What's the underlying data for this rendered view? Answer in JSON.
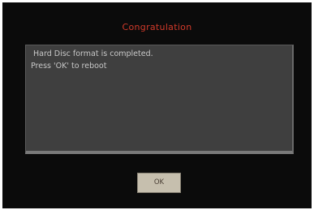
{
  "dialog": {
    "title": "Congratulation",
    "message_lines": [
      "Hard Disc format is completed.",
      "Press 'OK' to reboot"
    ],
    "ok_label": "OK"
  },
  "colors": {
    "background": "#0b0b0b",
    "title": "#d23a2a",
    "message_box": "#3f3f3f",
    "message_text": "#c8c8c8",
    "button_face": "#c6bfae"
  }
}
